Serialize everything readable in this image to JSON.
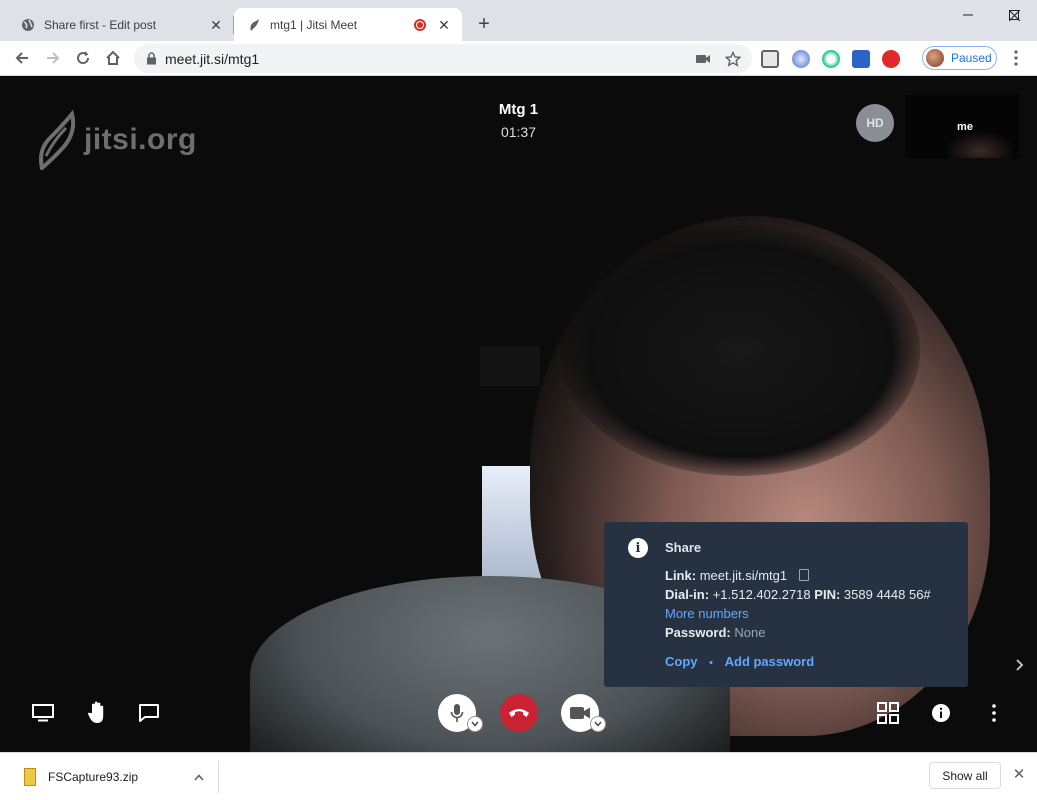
{
  "browser": {
    "tabs": [
      {
        "title": "Share first - Edit post",
        "favicon": "globe-icon",
        "active": false
      },
      {
        "title": "mtg1 | Jitsi Meet",
        "favicon": "jitsi-icon",
        "active": true,
        "recording": true
      }
    ],
    "url": "meet.jit.si/mtg1",
    "profile_status": "Paused"
  },
  "meeting": {
    "logo_text": "jitsi.org",
    "subject": "Mtg 1",
    "timer": "01:37",
    "quality_badge": "HD",
    "local_participant": "me"
  },
  "info_popup": {
    "title": "Share",
    "link_label": "Link:",
    "link_value": "meet.jit.si/mtg1",
    "dialin_label": "Dial-in:",
    "dialin_value": "+1.512.402.2718",
    "pin_label": "PIN:",
    "pin_value": "3589 4448 56#",
    "more_numbers": "More numbers",
    "password_label": "Password:",
    "password_value": "None",
    "copy_label": "Copy",
    "bullet": "•",
    "add_password_label": "Add password"
  },
  "downloads": {
    "file_name": "FSCapture93.zip",
    "show_all": "Show all"
  },
  "colors": {
    "hangup": "#cb2233",
    "popup_bg": "#263242",
    "link_blue": "#5fa8ff"
  }
}
